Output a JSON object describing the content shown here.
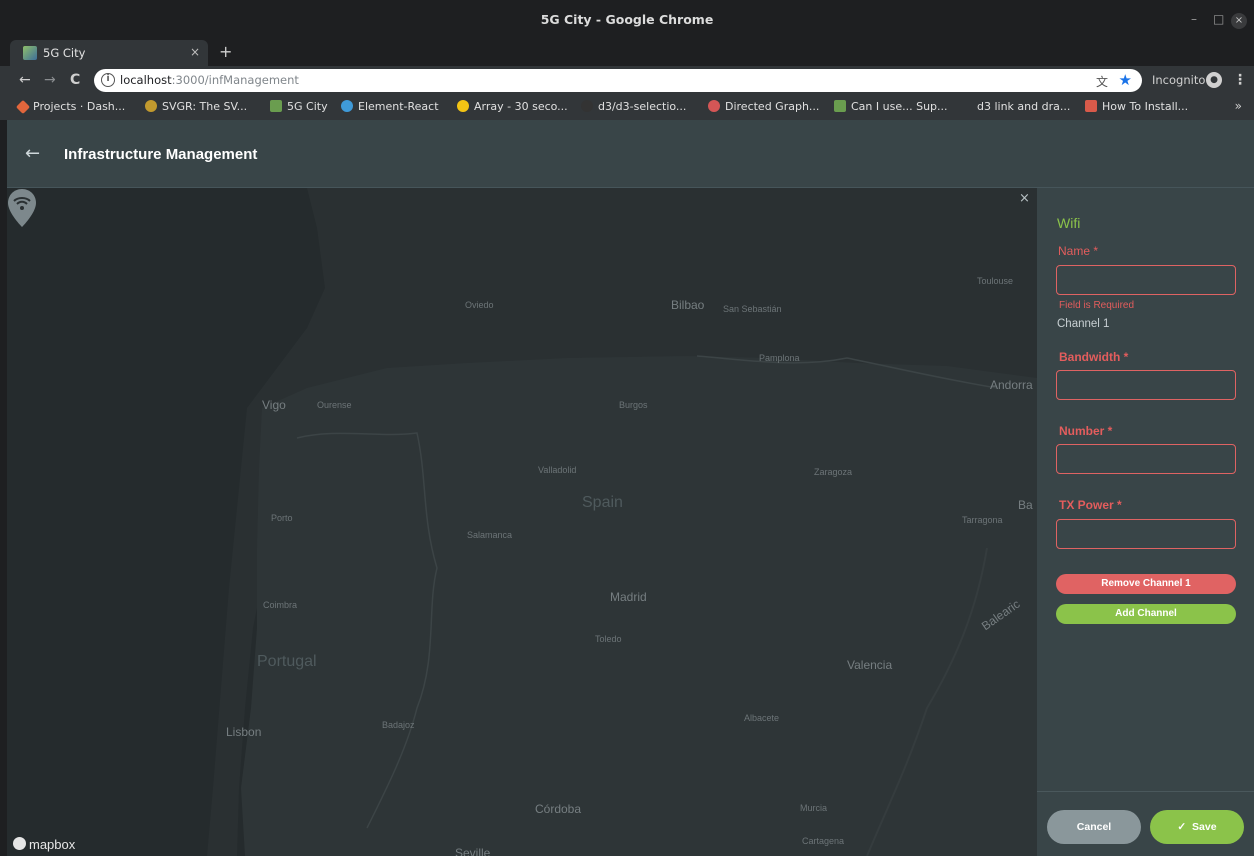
{
  "window": {
    "title": "5G City - Google Chrome",
    "minimize": "–",
    "maximize": "□",
    "close": "×"
  },
  "tab": {
    "label": "5G City",
    "close": "×",
    "new": "+"
  },
  "toolbar": {
    "back": "←",
    "forward": "→",
    "reload": "C",
    "url_host": "localhost",
    "url_path": ":3000/infManagement",
    "incognito_label": "Incognito",
    "menu": "⋮"
  },
  "bookmarks": [
    {
      "label": "Projects · Dash...",
      "color": "#e2663c"
    },
    {
      "label": "SVGR: The SV...",
      "color": "#c29a2e"
    },
    {
      "label": "5G City",
      "color": "#6a9d4f"
    },
    {
      "label": "Element-React",
      "color": "#3f9ad8"
    },
    {
      "label": "Array - 30 seco...",
      "color": "#f3c414"
    },
    {
      "label": "d3/d3-selectio...",
      "color": "#333333"
    },
    {
      "label": "Directed Graph...",
      "color": "#d45656"
    },
    {
      "label": "Can I use... Sup...",
      "color": "#6a9d4f"
    },
    {
      "label": "d3 link and dra...",
      "color": "#323639"
    },
    {
      "label": "How To Install...",
      "color": "#d85a4a"
    }
  ],
  "bookmarks_more": "»",
  "header": {
    "back": "←",
    "title": "Infrastructure Management"
  },
  "map": {
    "close": "×",
    "attribution": "mapbox",
    "labels": {
      "toulouse": "Toulouse",
      "oviedo": "Oviedo",
      "bilbao": "Bilbao",
      "san_sebastian": "San Sebastián",
      "pamplona": "Pamplona",
      "andorra": "Andorra",
      "vigo": "Vigo",
      "ourense": "Ourense",
      "burgos": "Burgos",
      "valladolid": "Valladolid",
      "zaragoza": "Zaragoza",
      "spain": "Spain",
      "ba": "Ba",
      "tarragona": "Tarragona",
      "porto": "Porto",
      "salamanca": "Salamanca",
      "madrid": "Madrid",
      "coimbra": "Coimbra",
      "toledo": "Toledo",
      "portugal": "Portugal",
      "balearic": "Balearic",
      "valencia": "Valencia",
      "lisbon": "Lisbon",
      "badajoz": "Badajoz",
      "albacete": "Albacete",
      "cordoba": "Córdoba",
      "murcia": "Murcia",
      "cartagena": "Cartagena",
      "seville": "Seville"
    }
  },
  "panel": {
    "heading": "Wifi",
    "name_label": "Name *",
    "name_error": "Field is Required",
    "channel_label": "Channel 1",
    "bandwidth_label": "Bandwidth *",
    "number_label": "Number *",
    "tx_power_label": "TX Power *",
    "remove_channel": "Remove Channel 1",
    "add_channel": "Add Channel",
    "cancel": "Cancel",
    "save": "Save"
  }
}
